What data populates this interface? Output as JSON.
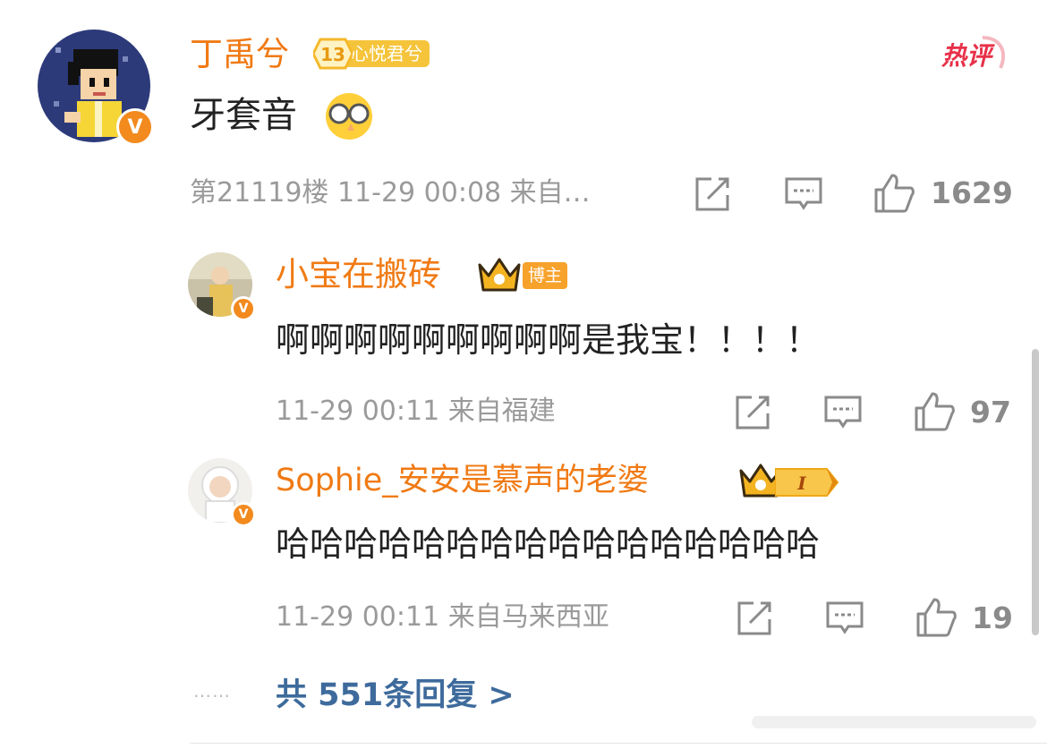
{
  "colors": {
    "username": "#f07a14",
    "reply_link": "#3e6b9c",
    "meta": "#9a9a9a",
    "hot_tag": "#e8314a",
    "fan_badge": "#f5c43a",
    "bozhu_badge": "#f7a22b"
  },
  "main_comment": {
    "username": "丁禹兮",
    "fan_level": "13",
    "fan_label": "心悦君兮",
    "content": "牙套音",
    "emoji": "glasses-emoji",
    "floor_time_source": "第21119楼 11-29 00:08 来自…",
    "likes": "1629",
    "hot_tag": "热评"
  },
  "replies": [
    {
      "username": "小宝在搬砖",
      "badge": "博主",
      "content": "啊啊啊啊啊啊啊啊啊是我宝！！！！",
      "time_source": "11-29 00:11 来自福建",
      "likes": "97"
    },
    {
      "username": "Sophie_安安是慕声的老婆",
      "rank_label": "I",
      "content": "哈哈哈哈哈哈哈哈哈哈哈哈哈哈哈哈",
      "time_source": "11-29 00:11 来自马来西亚",
      "likes": "19"
    }
  ],
  "more_replies": {
    "dots": "……",
    "label": "共 551条回复 >"
  }
}
